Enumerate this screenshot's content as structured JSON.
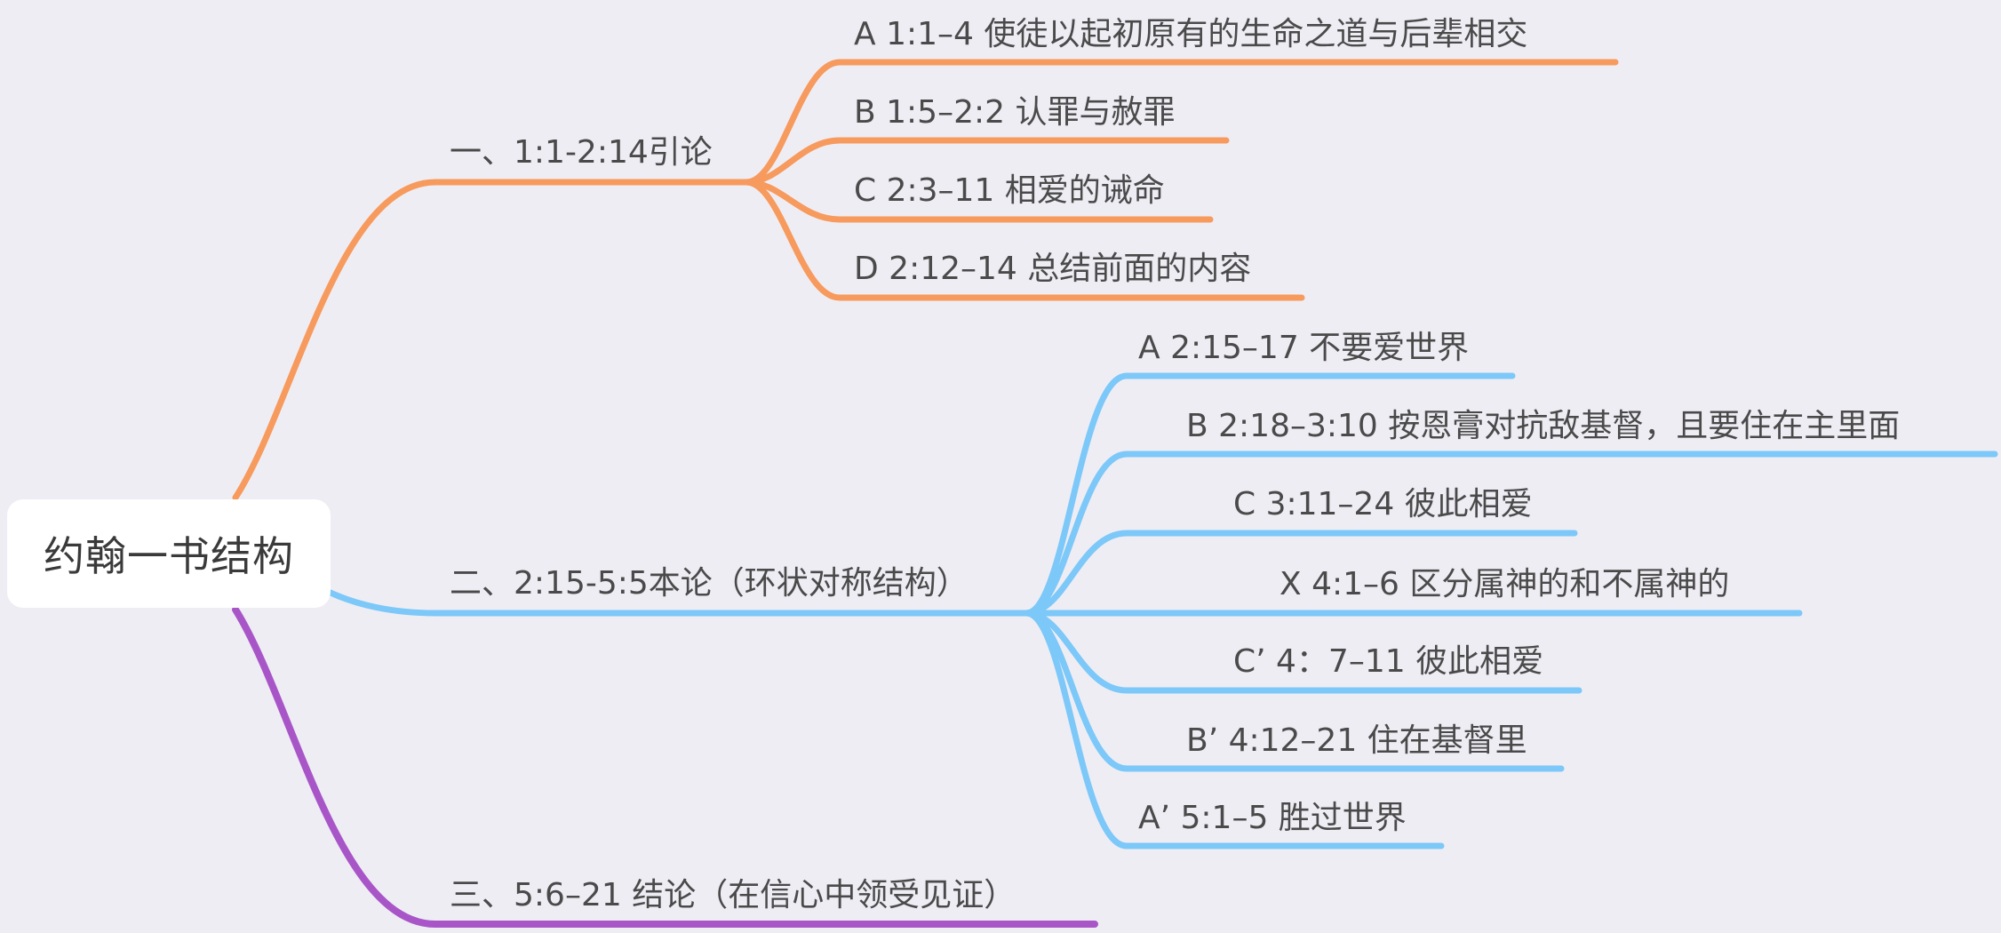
{
  "root": {
    "label": "约翰一书结构"
  },
  "colors": {
    "background": "#efedf4",
    "branch1": "#f79a5d",
    "branch2": "#7cc8f8",
    "branch3": "#a855c8",
    "text": "#4a4a4a"
  },
  "branches": [
    {
      "label": "一、1:1-2:14引论",
      "color": "#f79a5d",
      "children": [
        {
          "label": "A  1:1–4 使徒以起初原有的生命之道与后辈相交"
        },
        {
          "label": "B  1:5–2:2 认罪与赦罪"
        },
        {
          "label": "C  2:3–11 相爱的诫命"
        },
        {
          "label": "D  2:12–14 总结前面的内容"
        }
      ]
    },
    {
      "label": "二、2:15-5:5本论（环状对称结构）",
      "color": "#7cc8f8",
      "children": [
        {
          "label": "A  2:15–17 不要爱世界"
        },
        {
          "label": "B  2:18–3:10 按恩膏对抗敌基督，且要住在主里面"
        },
        {
          "label": "C  3:11–24 彼此相爱"
        },
        {
          "label": "X  4:1–6 区分属神的和不属神的"
        },
        {
          "label": "C’ 4：7–11 彼此相爱"
        },
        {
          "label": "B’ 4:12–21 住在基督里"
        },
        {
          "label": "A’ 5:1–5 胜过世界"
        }
      ]
    },
    {
      "label": "三、5:6–21  结论（在信心中领受见证）",
      "color": "#a855c8",
      "children": []
    }
  ]
}
